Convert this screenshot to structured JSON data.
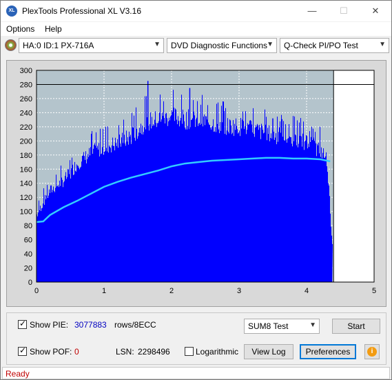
{
  "window": {
    "title": "PlexTools Professional XL V3.16",
    "app_icon": "XL",
    "minimize_glyph": "—",
    "maximize_glyph": "☐",
    "close_glyph": "✕"
  },
  "menu": {
    "options": "Options",
    "help": "Help"
  },
  "toolbar": {
    "drive": "HA:0 ID:1  PX-716A",
    "function": "DVD Diagnostic Functions",
    "test": "Q-Check PI/PO Test"
  },
  "chart_data": {
    "type": "area",
    "title": "",
    "xlabel": "",
    "ylabel": "",
    "xlim": [
      0,
      5
    ],
    "ylim": [
      0,
      300
    ],
    "x_ticks": [
      "0",
      "1",
      "2",
      "3",
      "4",
      "5"
    ],
    "y_ticks": [
      "0",
      "20",
      "40",
      "60",
      "80",
      "100",
      "120",
      "140",
      "160",
      "180",
      "200",
      "220",
      "240",
      "260",
      "280",
      "300"
    ],
    "reference_line_y": 280,
    "end_marker_x": 4.4,
    "colors": {
      "pie_fill": "#0000ff",
      "average_line": "#33ccff",
      "plot_bg": "#b4c4cc",
      "unused_bg": "#ffffff"
    },
    "series": [
      {
        "kind": "bars",
        "x": [
          0.0,
          0.2,
          0.4,
          0.6,
          0.8,
          1.0,
          1.2,
          1.4,
          1.6,
          1.8,
          2.0,
          2.2,
          2.4,
          2.6,
          2.8,
          3.0,
          3.2,
          3.4,
          3.6,
          3.8,
          4.0,
          4.2,
          4.3,
          4.38
        ],
        "values": [
          100,
          135,
          150,
          175,
          190,
          200,
          205,
          215,
          235,
          240,
          245,
          240,
          240,
          235,
          230,
          230,
          225,
          220,
          215,
          210,
          205,
          195,
          180,
          50
        ],
        "peaks": [
          [
            1.65,
            285
          ],
          [
            2.27,
            275
          ],
          [
            3.5,
            232
          ],
          [
            4.1,
            205
          ]
        ]
      },
      {
        "kind": "line",
        "x": [
          0.0,
          0.1,
          0.2,
          0.4,
          0.6,
          0.8,
          1.0,
          1.2,
          1.4,
          1.6,
          1.8,
          2.0,
          2.2,
          2.4,
          2.6,
          2.8,
          3.0,
          3.2,
          3.4,
          3.6,
          3.8,
          4.0,
          4.2,
          4.35
        ],
        "values": [
          85,
          86,
          95,
          106,
          115,
          125,
          135,
          142,
          148,
          153,
          158,
          164,
          168,
          170,
          172,
          173,
          174,
          175,
          176,
          176,
          175,
          175,
          174,
          171
        ]
      }
    ]
  },
  "controls": {
    "show_pie_label": "Show PIE:",
    "pie_total": "3077883",
    "pie_unit": "rows/8ECC",
    "show_pof_label": "Show POF:",
    "pof_total": "0",
    "lsn_label": "LSN:",
    "lsn_value": "2298496",
    "logarithmic_label": "Logarithmic",
    "test_select": "SUM8 Test",
    "start_label": "Start",
    "view_log_label": "View Log",
    "preferences_label": "Preferences",
    "info_glyph": "i"
  },
  "status": {
    "text": "Ready"
  }
}
